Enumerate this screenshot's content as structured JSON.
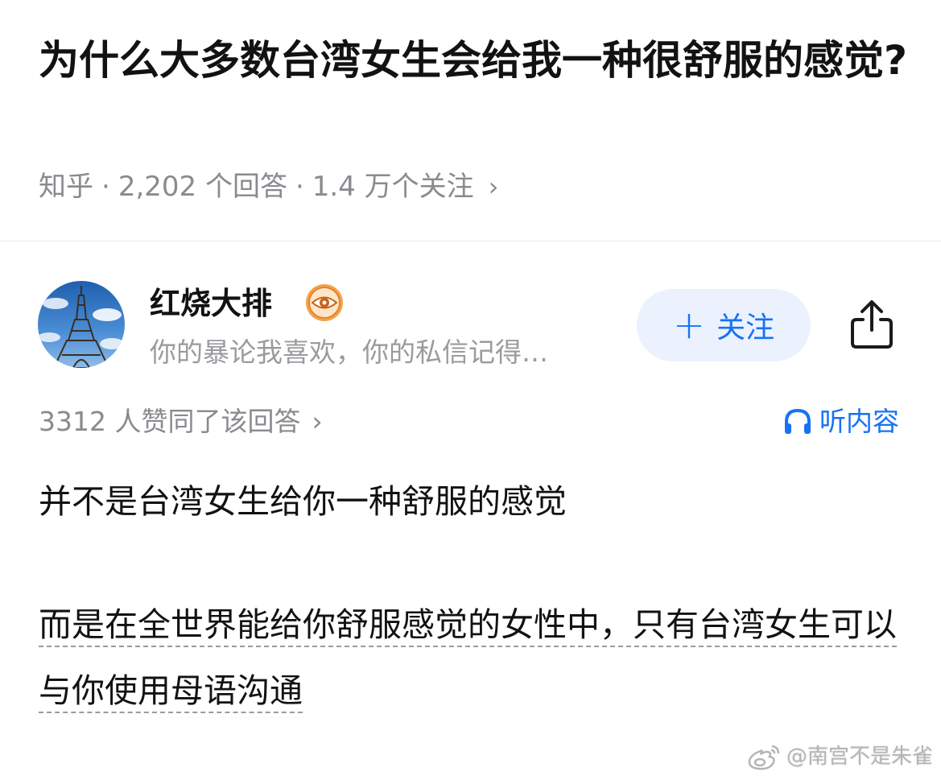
{
  "question": {
    "title": "为什么大多数台湾女生会给我一种很舒服的感觉?",
    "source": "知乎",
    "answers_count": "2,202 个回答",
    "followers_count": "1.4 万个关注",
    "separator": "·",
    "chevron": "›"
  },
  "author": {
    "name": "红烧大排",
    "bio": "你的暴论我喜欢，你的私信记得…",
    "follow_label": "关注",
    "follow_plus": "+"
  },
  "answer": {
    "upvote_summary": "3312 人赞同了该回答",
    "chevron": "›",
    "listen_label": "听内容",
    "paragraph_1": "并不是台湾女生给你一种舒服的感觉",
    "paragraph_2": "而是在全世界能给你舒服感觉的女性中，只有台湾女生可以与你使用母语沟通"
  },
  "watermark": {
    "text": "@南宫不是朱雀"
  },
  "colors": {
    "accent": "#1772f6",
    "follow_bg": "#ebf2fe",
    "meta_text": "#8a8a8f",
    "badge": "#e8822a"
  },
  "icons": {
    "badge": "eye-badge-icon",
    "share": "share-icon",
    "listen": "headphones-icon",
    "watermark": "weibo-icon"
  }
}
